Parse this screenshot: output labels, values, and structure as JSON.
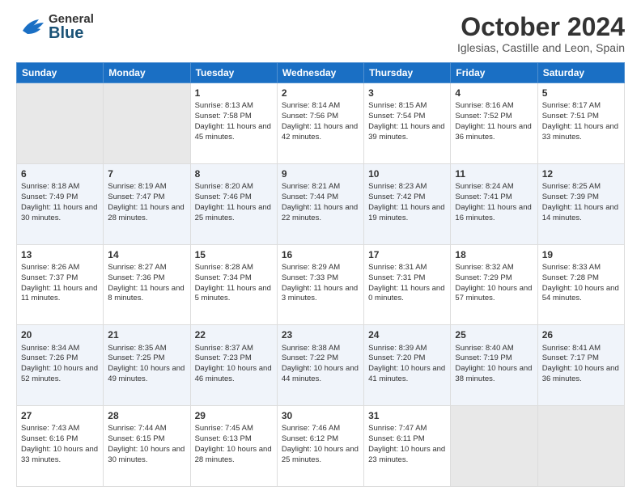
{
  "header": {
    "logo_general": "General",
    "logo_blue": "Blue",
    "month_title": "October 2024",
    "location": "Iglesias, Castille and Leon, Spain"
  },
  "weekdays": [
    "Sunday",
    "Monday",
    "Tuesday",
    "Wednesday",
    "Thursday",
    "Friday",
    "Saturday"
  ],
  "weeks": [
    [
      {
        "day": "",
        "info": ""
      },
      {
        "day": "",
        "info": ""
      },
      {
        "day": "1",
        "info": "Sunrise: 8:13 AM\nSunset: 7:58 PM\nDaylight: 11 hours and 45 minutes."
      },
      {
        "day": "2",
        "info": "Sunrise: 8:14 AM\nSunset: 7:56 PM\nDaylight: 11 hours and 42 minutes."
      },
      {
        "day": "3",
        "info": "Sunrise: 8:15 AM\nSunset: 7:54 PM\nDaylight: 11 hours and 39 minutes."
      },
      {
        "day": "4",
        "info": "Sunrise: 8:16 AM\nSunset: 7:52 PM\nDaylight: 11 hours and 36 minutes."
      },
      {
        "day": "5",
        "info": "Sunrise: 8:17 AM\nSunset: 7:51 PM\nDaylight: 11 hours and 33 minutes."
      }
    ],
    [
      {
        "day": "6",
        "info": "Sunrise: 8:18 AM\nSunset: 7:49 PM\nDaylight: 11 hours and 30 minutes."
      },
      {
        "day": "7",
        "info": "Sunrise: 8:19 AM\nSunset: 7:47 PM\nDaylight: 11 hours and 28 minutes."
      },
      {
        "day": "8",
        "info": "Sunrise: 8:20 AM\nSunset: 7:46 PM\nDaylight: 11 hours and 25 minutes."
      },
      {
        "day": "9",
        "info": "Sunrise: 8:21 AM\nSunset: 7:44 PM\nDaylight: 11 hours and 22 minutes."
      },
      {
        "day": "10",
        "info": "Sunrise: 8:23 AM\nSunset: 7:42 PM\nDaylight: 11 hours and 19 minutes."
      },
      {
        "day": "11",
        "info": "Sunrise: 8:24 AM\nSunset: 7:41 PM\nDaylight: 11 hours and 16 minutes."
      },
      {
        "day": "12",
        "info": "Sunrise: 8:25 AM\nSunset: 7:39 PM\nDaylight: 11 hours and 14 minutes."
      }
    ],
    [
      {
        "day": "13",
        "info": "Sunrise: 8:26 AM\nSunset: 7:37 PM\nDaylight: 11 hours and 11 minutes."
      },
      {
        "day": "14",
        "info": "Sunrise: 8:27 AM\nSunset: 7:36 PM\nDaylight: 11 hours and 8 minutes."
      },
      {
        "day": "15",
        "info": "Sunrise: 8:28 AM\nSunset: 7:34 PM\nDaylight: 11 hours and 5 minutes."
      },
      {
        "day": "16",
        "info": "Sunrise: 8:29 AM\nSunset: 7:33 PM\nDaylight: 11 hours and 3 minutes."
      },
      {
        "day": "17",
        "info": "Sunrise: 8:31 AM\nSunset: 7:31 PM\nDaylight: 11 hours and 0 minutes."
      },
      {
        "day": "18",
        "info": "Sunrise: 8:32 AM\nSunset: 7:29 PM\nDaylight: 10 hours and 57 minutes."
      },
      {
        "day": "19",
        "info": "Sunrise: 8:33 AM\nSunset: 7:28 PM\nDaylight: 10 hours and 54 minutes."
      }
    ],
    [
      {
        "day": "20",
        "info": "Sunrise: 8:34 AM\nSunset: 7:26 PM\nDaylight: 10 hours and 52 minutes."
      },
      {
        "day": "21",
        "info": "Sunrise: 8:35 AM\nSunset: 7:25 PM\nDaylight: 10 hours and 49 minutes."
      },
      {
        "day": "22",
        "info": "Sunrise: 8:37 AM\nSunset: 7:23 PM\nDaylight: 10 hours and 46 minutes."
      },
      {
        "day": "23",
        "info": "Sunrise: 8:38 AM\nSunset: 7:22 PM\nDaylight: 10 hours and 44 minutes."
      },
      {
        "day": "24",
        "info": "Sunrise: 8:39 AM\nSunset: 7:20 PM\nDaylight: 10 hours and 41 minutes."
      },
      {
        "day": "25",
        "info": "Sunrise: 8:40 AM\nSunset: 7:19 PM\nDaylight: 10 hours and 38 minutes."
      },
      {
        "day": "26",
        "info": "Sunrise: 8:41 AM\nSunset: 7:17 PM\nDaylight: 10 hours and 36 minutes."
      }
    ],
    [
      {
        "day": "27",
        "info": "Sunrise: 7:43 AM\nSunset: 6:16 PM\nDaylight: 10 hours and 33 minutes."
      },
      {
        "day": "28",
        "info": "Sunrise: 7:44 AM\nSunset: 6:15 PM\nDaylight: 10 hours and 30 minutes."
      },
      {
        "day": "29",
        "info": "Sunrise: 7:45 AM\nSunset: 6:13 PM\nDaylight: 10 hours and 28 minutes."
      },
      {
        "day": "30",
        "info": "Sunrise: 7:46 AM\nSunset: 6:12 PM\nDaylight: 10 hours and 25 minutes."
      },
      {
        "day": "31",
        "info": "Sunrise: 7:47 AM\nSunset: 6:11 PM\nDaylight: 10 hours and 23 minutes."
      },
      {
        "day": "",
        "info": ""
      },
      {
        "day": "",
        "info": ""
      }
    ]
  ]
}
